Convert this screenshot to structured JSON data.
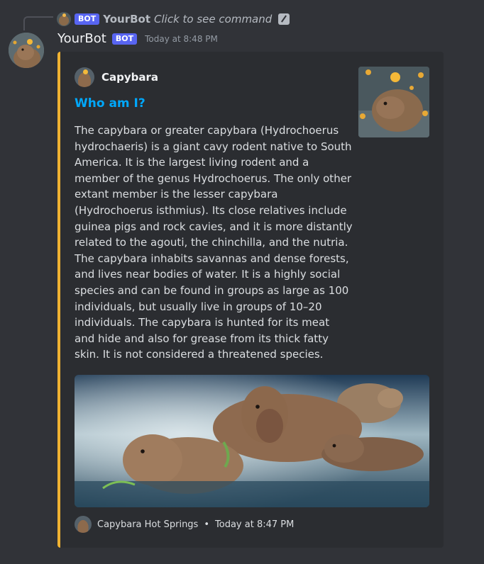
{
  "reply": {
    "bot_tag": "BOT",
    "name": "YourBot",
    "text": "Click to see command",
    "icon": "command-icon"
  },
  "message": {
    "username": "YourBot",
    "bot_tag": "BOT",
    "timestamp": "Today at 8:48 PM"
  },
  "embed": {
    "accent_color": "#f0b232",
    "author": "Capybara",
    "title": "Who am I?",
    "description": "The capybara or greater capybara (Hydrochoerus hydrochaeris) is a giant cavy rodent native to South America. It is the largest living rodent and a member of the genus Hydrochoerus. The only other extant member is the lesser capybara (Hydrochoerus isthmius). Its close relatives include guinea pigs and rock cavies, and it is more distantly related to the agouti, the chinchilla, and the nutria. The capybara inhabits savannas and dense forests, and lives near bodies of water. It is a highly social species and can be found in groups as large as 100 individuals, but usually live in groups of 10–20 individuals. The capybara is hunted for its meat and hide and also for grease from its thick fatty skin. It is not considered a threatened species.",
    "footer": "Capybara Hot Springs",
    "footer_separator": "•",
    "footer_timestamp": "Today at 8:47 PM"
  },
  "colors": {
    "background": "#313338",
    "embed_bg": "#2b2d31",
    "link_title": "#00a8fc",
    "bot_tag": "#5865f2"
  }
}
